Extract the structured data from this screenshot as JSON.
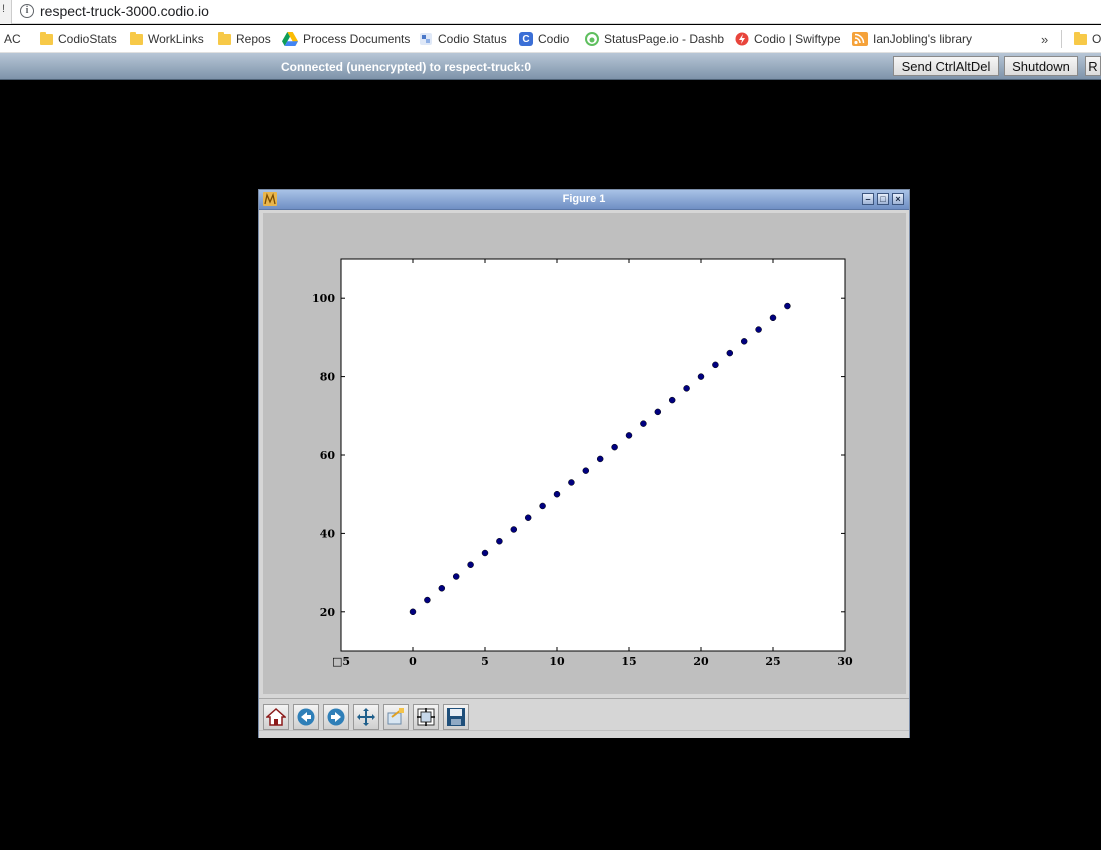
{
  "browser": {
    "url": "respect-truck-3000.codio.io",
    "edge_glyph": "!",
    "bookmarks": [
      {
        "label": "AC",
        "icon": "none"
      },
      {
        "label": "CodioStats",
        "icon": "folder-icon"
      },
      {
        "label": "WorkLinks",
        "icon": "folder-icon"
      },
      {
        "label": "Repos",
        "icon": "folder-icon"
      },
      {
        "label": "Process Documents",
        "icon": "google-drive-icon"
      },
      {
        "label": "Codio Status",
        "icon": "codio-status-icon"
      },
      {
        "label": "Codio",
        "icon": "codio-icon"
      },
      {
        "label": "StatusPage.io - Dashb",
        "icon": "statuspage-icon"
      },
      {
        "label": "Codio | Swiftype",
        "icon": "swiftype-icon"
      },
      {
        "label": "IanJobling's library",
        "icon": "rss-icon"
      }
    ],
    "overflow_label": "»",
    "other_label": "O"
  },
  "vnc": {
    "status": "Connected (unencrypted) to respect-truck:0",
    "send_ctrlaltdel": "Send CtrlAltDel",
    "shutdown": "Shutdown",
    "r_label": "R"
  },
  "figure": {
    "title": "Figure 1",
    "toolbar": [
      "home-icon",
      "back-icon",
      "forward-icon",
      "pan-icon",
      "zoom-icon",
      "configure-subplots-icon",
      "save-icon"
    ],
    "window_buttons": {
      "minimize": "–",
      "maximize": "□",
      "close": "×"
    }
  },
  "chart_data": {
    "type": "scatter",
    "title": "",
    "xlabel": "",
    "ylabel": "",
    "xlim": [
      -5,
      30
    ],
    "ylim": [
      10,
      110
    ],
    "xticks": [
      -5,
      0,
      5,
      10,
      15,
      20,
      25,
      30
    ],
    "xtick_labels": [
      "□5",
      "0",
      "5",
      "10",
      "15",
      "20",
      "25",
      "30"
    ],
    "yticks": [
      20,
      40,
      60,
      80,
      100
    ],
    "ytick_labels": [
      "20",
      "40",
      "60",
      "80",
      "100"
    ],
    "grid": false,
    "marker_color": "#00007f",
    "x": [
      0,
      1,
      2,
      3,
      4,
      5,
      6,
      7,
      8,
      9,
      10,
      11,
      12,
      13,
      14,
      15,
      16,
      17,
      18,
      19,
      20,
      21,
      22,
      23,
      24,
      25,
      26
    ],
    "y": [
      20,
      23,
      26,
      29,
      32,
      35,
      38,
      41,
      44,
      47,
      50,
      53,
      56,
      59,
      62,
      65,
      68,
      71,
      74,
      77,
      80,
      83,
      86,
      89,
      92,
      95,
      98
    ]
  }
}
